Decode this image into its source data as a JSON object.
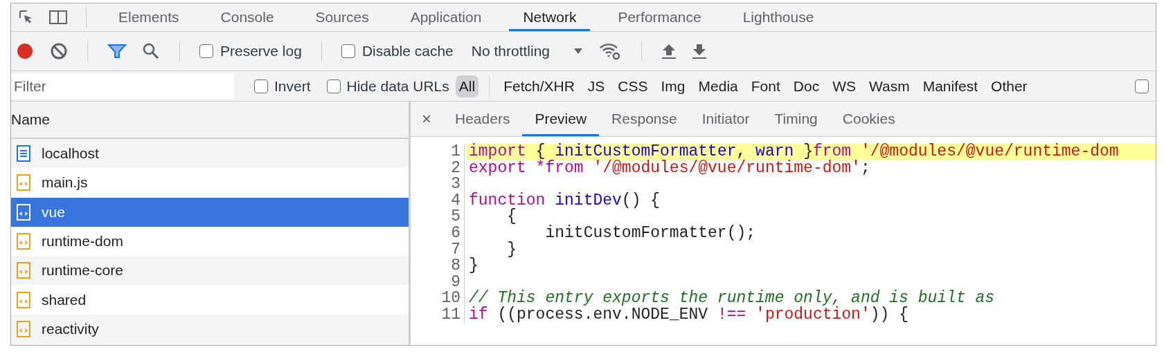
{
  "devtools_tabs": [
    {
      "label": "Elements",
      "selected": false
    },
    {
      "label": "Console",
      "selected": false
    },
    {
      "label": "Sources",
      "selected": false
    },
    {
      "label": "Application",
      "selected": false
    },
    {
      "label": "Network",
      "selected": true
    },
    {
      "label": "Performance",
      "selected": false
    },
    {
      "label": "Lighthouse",
      "selected": false
    }
  ],
  "toolbar": {
    "recording": true,
    "filter_active": true,
    "preserve_log": {
      "label": "Preserve log",
      "checked": false
    },
    "disable_cache": {
      "label": "Disable cache",
      "checked": false
    },
    "throttling": "No throttling"
  },
  "filter_bar": {
    "placeholder": "Filter",
    "invert": {
      "label": "Invert",
      "checked": false
    },
    "hide_data_urls": {
      "label": "Hide data URLs",
      "checked": false
    },
    "types": [
      {
        "label": "All",
        "selected": true
      },
      {
        "label": "Fetch/XHR",
        "selected": false
      },
      {
        "label": "JS",
        "selected": false
      },
      {
        "label": "CSS",
        "selected": false
      },
      {
        "label": "Img",
        "selected": false
      },
      {
        "label": "Media",
        "selected": false
      },
      {
        "label": "Font",
        "selected": false
      },
      {
        "label": "Doc",
        "selected": false
      },
      {
        "label": "WS",
        "selected": false
      },
      {
        "label": "Wasm",
        "selected": false
      },
      {
        "label": "Manifest",
        "selected": false
      },
      {
        "label": "Other",
        "selected": false
      }
    ],
    "trailing_checkbox": {
      "checked": false
    }
  },
  "requests": {
    "column": "Name",
    "items": [
      {
        "name": "localhost",
        "kind": "document",
        "selected": false
      },
      {
        "name": "main.js",
        "kind": "script",
        "selected": false
      },
      {
        "name": "vue",
        "kind": "script",
        "selected": true
      },
      {
        "name": "runtime-dom",
        "kind": "script",
        "selected": false
      },
      {
        "name": "runtime-core",
        "kind": "script",
        "selected": false
      },
      {
        "name": "shared",
        "kind": "script",
        "selected": false
      },
      {
        "name": "reactivity",
        "kind": "script",
        "selected": false
      }
    ]
  },
  "detail_tabs": {
    "close": "×",
    "tabs": [
      {
        "label": "Headers",
        "selected": false
      },
      {
        "label": "Preview",
        "selected": true
      },
      {
        "label": "Response",
        "selected": false
      },
      {
        "label": "Initiator",
        "selected": false
      },
      {
        "label": "Timing",
        "selected": false
      },
      {
        "label": "Cookies",
        "selected": false
      }
    ]
  },
  "preview": {
    "lines": [
      {
        "number": "1",
        "highlighted": true,
        "tokens": [
          {
            "kind": "keyword",
            "text": "import"
          },
          {
            "kind": "plain",
            "text": " { "
          },
          {
            "kind": "def",
            "text": "initCustomFormatter"
          },
          {
            "kind": "plain",
            "text": ", "
          },
          {
            "kind": "def",
            "text": "warn"
          },
          {
            "kind": "plain",
            "text": " }"
          },
          {
            "kind": "keyword",
            "text": "from "
          },
          {
            "kind": "string",
            "text": "'/@modules/@vue/runtime-dom"
          }
        ]
      },
      {
        "number": "2",
        "highlighted": false,
        "tokens": [
          {
            "kind": "keyword",
            "text": "export *from "
          },
          {
            "kind": "string",
            "text": "'/@modules/@vue/runtime-dom'"
          },
          {
            "kind": "plain",
            "text": ";"
          }
        ]
      },
      {
        "number": "3",
        "highlighted": false
      },
      {
        "number": "4",
        "highlighted": false,
        "tokens": [
          {
            "kind": "keyword",
            "text": "function "
          },
          {
            "kind": "def",
            "text": "initDev"
          },
          {
            "kind": "plain",
            "text": "() {"
          }
        ]
      },
      {
        "number": "5",
        "highlighted": false,
        "tokens": [
          {
            "kind": "plain",
            "text": "    {"
          }
        ]
      },
      {
        "number": "6",
        "highlighted": false,
        "tokens": [
          {
            "kind": "plain",
            "text": "        initCustomFormatter();"
          }
        ]
      },
      {
        "number": "7",
        "highlighted": false,
        "tokens": [
          {
            "kind": "plain",
            "text": "    }"
          }
        ]
      },
      {
        "number": "8",
        "highlighted": false,
        "tokens": [
          {
            "kind": "plain",
            "text": "}"
          }
        ]
      },
      {
        "number": "9",
        "highlighted": false
      },
      {
        "number": "10",
        "highlighted": false,
        "tokens": [
          {
            "kind": "comment",
            "text": "// This entry exports the runtime only, and is built as"
          }
        ]
      },
      {
        "number": "11",
        "highlighted": false,
        "tokens": [
          {
            "kind": "keyword",
            "text": "if"
          },
          {
            "kind": "plain",
            "text": " ((process.env.NODE_ENV "
          },
          {
            "kind": "keyword",
            "text": "!== "
          },
          {
            "kind": "string",
            "text": "'production'"
          },
          {
            "kind": "plain",
            "text": ")) {"
          }
        ]
      }
    ]
  }
}
